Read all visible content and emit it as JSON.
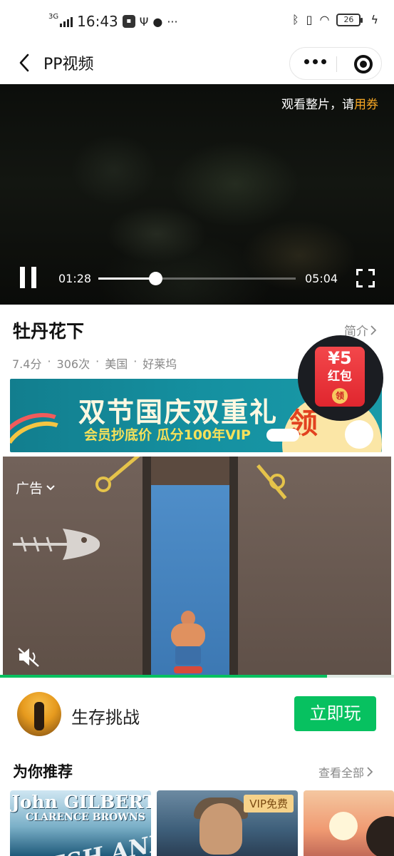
{
  "status_bar": {
    "network": "3G",
    "time": "16:43",
    "battery": "26"
  },
  "nav": {
    "title": "PP视频"
  },
  "video": {
    "watch_prefix": "观看整片，请",
    "watch_coupon": "用券",
    "current_time": "01:28",
    "total_time": "05:04",
    "progress": 0.29
  },
  "movie": {
    "title": "牡丹花下",
    "intro_label": "简介",
    "rating": "7.4分",
    "views": "306次",
    "region": "美国",
    "studio": "好莱坞",
    "meta_separator": "·"
  },
  "red_packet": {
    "amount": "¥5",
    "label": "红包",
    "seal": "领"
  },
  "promo_banner": {
    "headline": "双节国庆双重礼",
    "subline": "会员抄底价  瓜分100年VIP",
    "badge": "领"
  },
  "ad": {
    "label": "广告",
    "progress": 0.83
  },
  "game_ad": {
    "name": "生存挑战",
    "cta": "立即玩"
  },
  "recommend": {
    "title": "为你推荐",
    "see_all": "查看全部",
    "cards": [
      {
        "line1": "John GILBERT",
        "line2": "CLARENCE BROWNS",
        "line3": "FLESH AND THE DEVIL"
      },
      {
        "badge": "VIP免费"
      },
      {}
    ]
  },
  "colors": {
    "accent_green": "#07c160",
    "coupon_orange": "#f6a623",
    "red_packet": "#e0262e"
  },
  "icons": [
    "back-arrow-icon",
    "more-dots-icon",
    "close-target-icon",
    "pause-icon",
    "fullscreen-icon",
    "chevron-right-icon",
    "chevron-down-icon",
    "mute-icon",
    "bluetooth-icon",
    "vibrate-icon",
    "wifi-icon",
    "usb-icon",
    "chat-icon",
    "bolt-icon"
  ]
}
